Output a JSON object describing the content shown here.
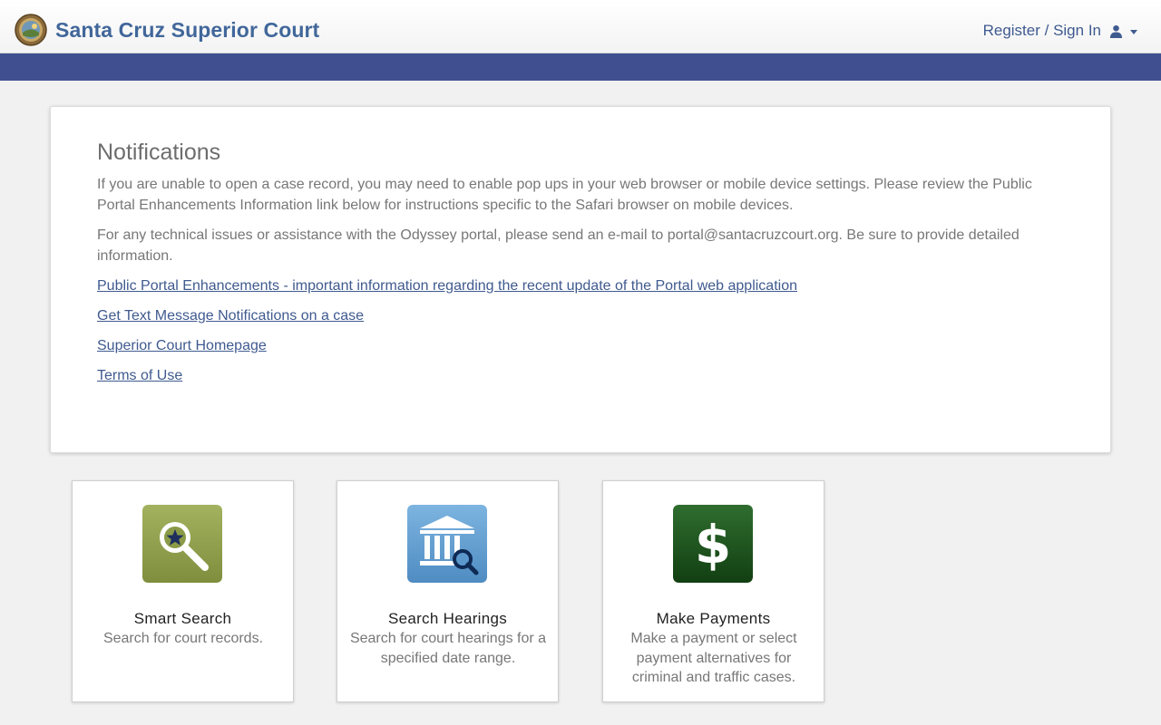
{
  "header": {
    "title": "Santa Cruz Superior Court",
    "signin_label": "Register / Sign In",
    "seal_icon": "court-seal-icon",
    "user_icon": "user-icon"
  },
  "notifications": {
    "heading": "Notifications",
    "paragraphs": [
      "If you are unable to open a case record, you may need to enable pop ups in your web browser or mobile device settings. Please review the Public Portal Enhancements Information link below for instructions specific to the Safari browser on mobile devices.",
      "For any technical issues or assistance with the Odyssey portal, please send an e-mail to portal@santacruzcourt.org. Be sure to provide detailed information."
    ],
    "links": [
      "Public Portal Enhancements - important information regarding the recent update of the Portal web application",
      "Get Text Message Notifications on a case",
      "Superior Court Homepage",
      "Terms of Use"
    ]
  },
  "tiles": [
    {
      "title": "Smart Search",
      "desc": "Search for court records.",
      "icon": "magnifier-star-icon",
      "color": "#8a9a47"
    },
    {
      "title": "Search Hearings",
      "desc": "Search for court hearings for a specified date range.",
      "icon": "courthouse-search-icon",
      "color": "#5b98cc"
    },
    {
      "title": "Make Payments",
      "desc": "Make a payment or select payment alternatives for criminal and traffic cases.",
      "icon": "dollar-sign-icon",
      "color": "#1f5a1f"
    }
  ],
  "colors": {
    "brand_blue": "#41679a",
    "nav_bar": "#404f90",
    "link": "#3f5a8f"
  }
}
